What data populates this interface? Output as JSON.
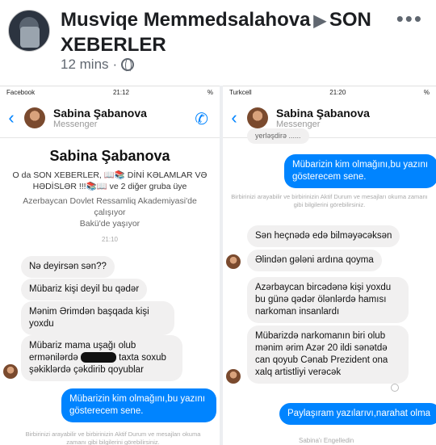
{
  "post": {
    "author": "Musviqe Memmedsalahova",
    "group": "SON XEBERLER",
    "time": "12 mins",
    "separator": "·"
  },
  "left": {
    "status": {
      "carrier": "Facebook",
      "time": "21:12",
      "battery": "%"
    },
    "contact": {
      "name": "Sabina Şabanova",
      "sub": "Messenger"
    },
    "profile": {
      "name": "Sabina Şabanova",
      "line1": "O da SON XEBERLER, 📖📚 DİNİ KƏLAMLAR VƏ",
      "line2": "HƏDİSLƏR !!!📚📖 ve 2 diğer gruba üye",
      "line3": "Azerbaycan Dovlet Ressamliq Akademiyasi'de",
      "line4": "çalışıyor",
      "line5": "Bakü'de yaşıyor"
    },
    "timestamp": "21:10",
    "messages": [
      "Nə deyirsən sən??",
      "Mübariz kişi deyil bu qədər",
      "Mənim Ərimdən başqada kişi yoxdu",
      "Mübariz mama uşağı olub ermənilərdə",
      "taxta soxub şəkiklərdə çəkdirib qoyublar"
    ],
    "my_message": "Mübarizin kim olmağını,bu yazını gösterecem sene.",
    "info": "Birbirinizi arayabilir ve birbirinizin Aktif Durum ve mesajları okuma zamanı gibi bilgilerini görebilirsiniz."
  },
  "right": {
    "status": {
      "carrier": "Turkcell",
      "time": "21:20",
      "battery": "%"
    },
    "contact": {
      "name": "Sabina Şabanova",
      "sub": "Messenger"
    },
    "top_cut": "yerləşdirə ......",
    "my_message": "Mübarizin kim olmağını,bu yazını gösterecem sene.",
    "info": "Birbirinizi arayabilir ve birbirinizin Aktif Durum ve mesajları okuma zamanı gibi bilgilerini görebilirsiniz.",
    "messages": [
      "Sən heçnədə edə bilməyəcəksən",
      "Əlindən gələni ardına qoyma",
      "Azərbaycan bircədənə kişi yoxdu bu günə qədər ölənlərdə hamısı narkoman insanlardı",
      "Mübarizdə narkomanın biri olub mənim ərim Azər 20 ildi sənətdə can qoyub Cənab Prezident ona xalq artistliyi verəcək"
    ],
    "my_message2": "Paylaşıram yazılarıvı,narahat olma",
    "bottom": "Sabina'ı Engelledin"
  },
  "colors": {
    "messenger_blue": "#0084ff",
    "bubble_grey": "#f1f0f0"
  },
  "icons": [
    "back-icon",
    "phone-icon",
    "globe-icon",
    "more-icon"
  ]
}
